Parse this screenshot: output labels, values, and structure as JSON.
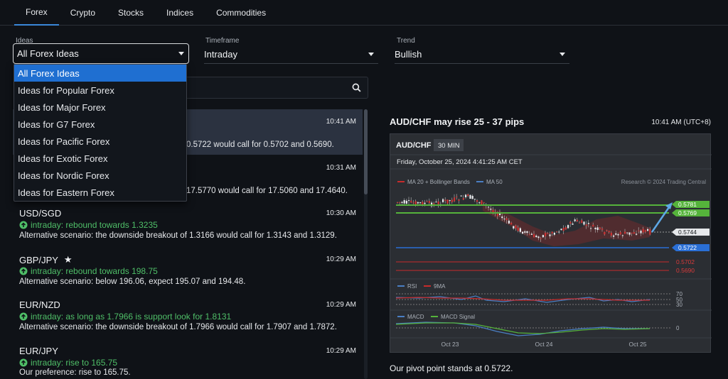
{
  "tabs": [
    "Forex",
    "Crypto",
    "Stocks",
    "Indices",
    "Commodities"
  ],
  "filters": {
    "ideas": {
      "label": "Ideas",
      "value": "All Forex Ideas"
    },
    "timeframe": {
      "label": "Timeframe",
      "value": "Intraday"
    },
    "trend": {
      "label": "Trend",
      "value": "Bullish"
    }
  },
  "dropdown_options": [
    "All Forex Ideas",
    "Ideas for Popular Forex",
    "Ideas for Major Forex",
    "Ideas for G7 Forex",
    "Ideas for Pacific Forex",
    "Ideas for Exotic Forex",
    "Ideas for Nordic Forex",
    "Ideas for Eastern Forex"
  ],
  "ideas": [
    {
      "symbol": "",
      "time": "10:41 AM",
      "signal": "",
      "alternative": "0.5722 would call for 0.5702 and 0.5690."
    },
    {
      "symbol": "",
      "time": "10:31 AM",
      "signal": "",
      "alternative": "17.5770 would call for 17.5060 and 17.4640."
    },
    {
      "symbol": "USD/SGD",
      "time": "10:30 AM",
      "signal": "intraday: rebound towards 1.3235",
      "alternative": "Alternative scenario: the downside breakout of 1.3166 would call for 1.3143 and 1.3129."
    },
    {
      "symbol": "GBP/JPY",
      "time": "10:29 AM",
      "signal": "intraday: rebound towards 198.75",
      "alternative": "Alternative scenario: below 196.06, expect 195.07 and 194.48."
    },
    {
      "symbol": "EUR/NZD",
      "time": "10:29 AM",
      "signal": "intraday: as long as 1.7966 is support look for 1.8131",
      "alternative": "Alternative scenario: the downside breakout of 1.7966 would call for 1.7907 and 1.7872."
    },
    {
      "symbol": "EUR/JPY",
      "time": "10:29 AM",
      "signal": "intraday: rise to 165.75",
      "alternative": "Our preference: rise to 165.75."
    }
  ],
  "detail": {
    "title": "AUD/CHF may rise 25 - 37 pips",
    "time": "10:41 AM (UTC+8)",
    "pivot_text": "Our pivot point stands at 0.5722."
  },
  "chart": {
    "symbol": "AUD/CHF",
    "interval": "30 MIN",
    "date": "Friday, October 25, 2024 4:41:25 AM CET",
    "legend_ma20": "MA 20 + Bollinger Bands",
    "legend_ma50": "MA 50",
    "copyright": "Research © 2024 Trading Central",
    "levels": [
      "0.5781",
      "0.5769",
      "0.5744",
      "0.5722",
      "0.5702",
      "0.5690"
    ],
    "rsi_label": "RSI",
    "ma9_label": "9MA",
    "rsi_ticks": [
      "70",
      "50",
      "30"
    ],
    "macd_label": "MACD",
    "macd_signal_label": "MACD Signal",
    "macd_tick": "0",
    "x_ticks": [
      "Oct 23",
      "Oct 24",
      "Oct 25"
    ],
    "colors": {
      "green": "#55b33b",
      "blue": "#2a6fd6",
      "red": "#c72b2b",
      "ma50": "#4a7fc4"
    }
  }
}
